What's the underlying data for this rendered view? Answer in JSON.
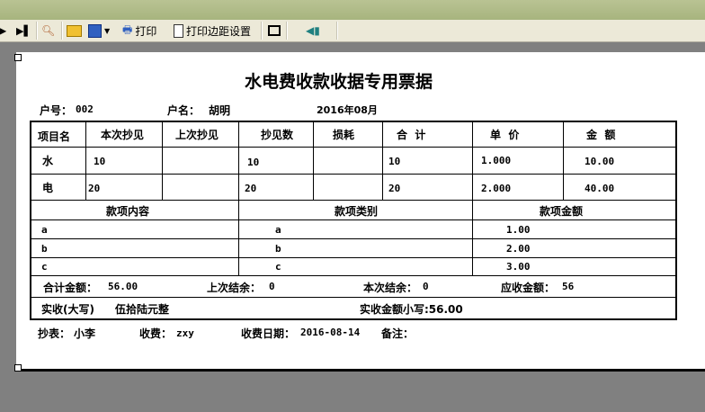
{
  "toolbar": {
    "print_label": "打印",
    "margin_label": "打印边距设置"
  },
  "receipt": {
    "title": "水电费收款收据专用票据",
    "account_no_label": "户号：",
    "account_no": "002",
    "name_label": "户名：",
    "name": "胡明",
    "period": "2016年08月",
    "headers": [
      "项目名",
      "本次抄见",
      "上次抄见",
      "抄见数",
      "损耗",
      "合  计",
      "单  价",
      "金  额"
    ],
    "rows": [
      {
        "item": "水",
        "current": "10",
        "previous": "",
        "reading": "10",
        "loss": "",
        "total": "10",
        "unit_price": "1.000",
        "amount": "10.00"
      },
      {
        "item": "电",
        "current": "20",
        "previous": "",
        "reading": "20",
        "loss": "",
        "total": "20",
        "unit_price": "2.000",
        "amount": "40.00"
      }
    ],
    "fee_headers": [
      "款项内容",
      "款项类别",
      "款项金额"
    ],
    "fees": [
      {
        "content": "a",
        "category": "a",
        "amount": "1.00"
      },
      {
        "content": "b",
        "category": "b",
        "amount": "2.00"
      },
      {
        "content": "c",
        "category": "c",
        "amount": "3.00"
      }
    ],
    "total_label": "合计金额：",
    "total": "56.00",
    "prev_balance_label": "上次结余：",
    "prev_balance": "0",
    "curr_balance_label": "本次结余：",
    "curr_balance": "0",
    "due_label": "应收金额：",
    "due": "56",
    "paid_upper_label": "实收(大写)",
    "paid_upper": "伍拾陆元整",
    "paid_lower": "实收金额小写:56.00",
    "reader_label": "抄表：",
    "reader": "小李",
    "collector_label": "收费：",
    "collector": "zxy",
    "date_label": "收费日期：",
    "date": "2016-08-14",
    "note_label": "备注："
  }
}
